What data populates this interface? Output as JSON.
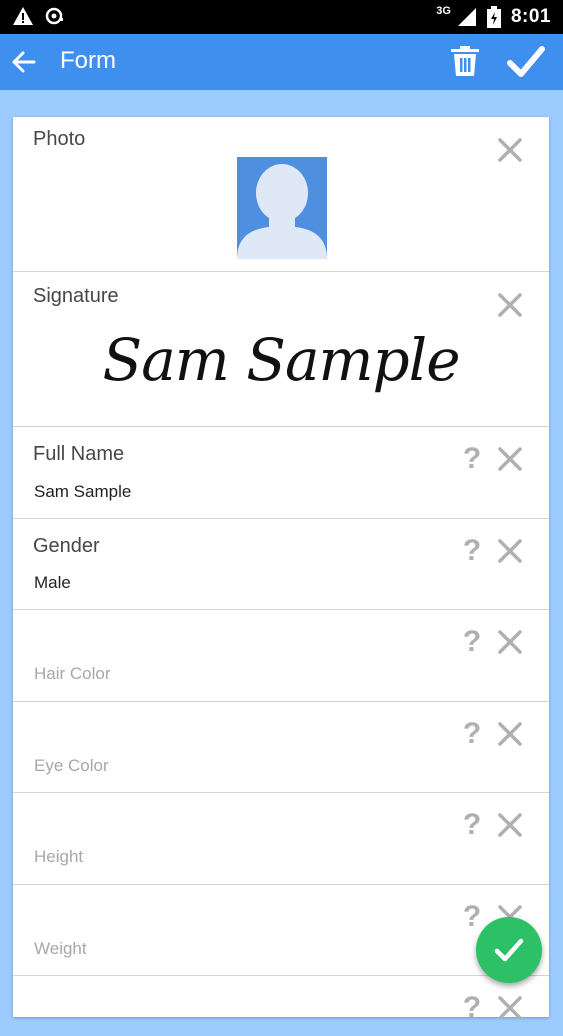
{
  "status_bar": {
    "time": "8:01",
    "network": "3G"
  },
  "app_bar": {
    "title": "Form"
  },
  "fields": {
    "photo": {
      "label": "Photo"
    },
    "signature": {
      "label": "Signature",
      "text": "Sam Sample"
    },
    "full_name": {
      "label": "Full Name",
      "value": "Sam Sample"
    },
    "gender": {
      "label": "Gender",
      "value": "Male"
    },
    "hair_color": {
      "placeholder": "Hair Color"
    },
    "eye_color": {
      "placeholder": "Eye Color"
    },
    "height": {
      "placeholder": "Height"
    },
    "weight": {
      "placeholder": "Weight"
    }
  },
  "help_glyph": "?",
  "colors": {
    "app_bar": "#3f90ee",
    "background": "#9ccbff",
    "fab": "#2cc167",
    "photo_bg": "#4f8fe0",
    "photo_silhouette": "#dfe8f7"
  },
  "icons": [
    "back-arrow-icon",
    "trash-icon",
    "check-icon",
    "close-icon",
    "help-icon",
    "avatar-silhouette",
    "warning-icon",
    "signal-icon",
    "battery-icon"
  ]
}
